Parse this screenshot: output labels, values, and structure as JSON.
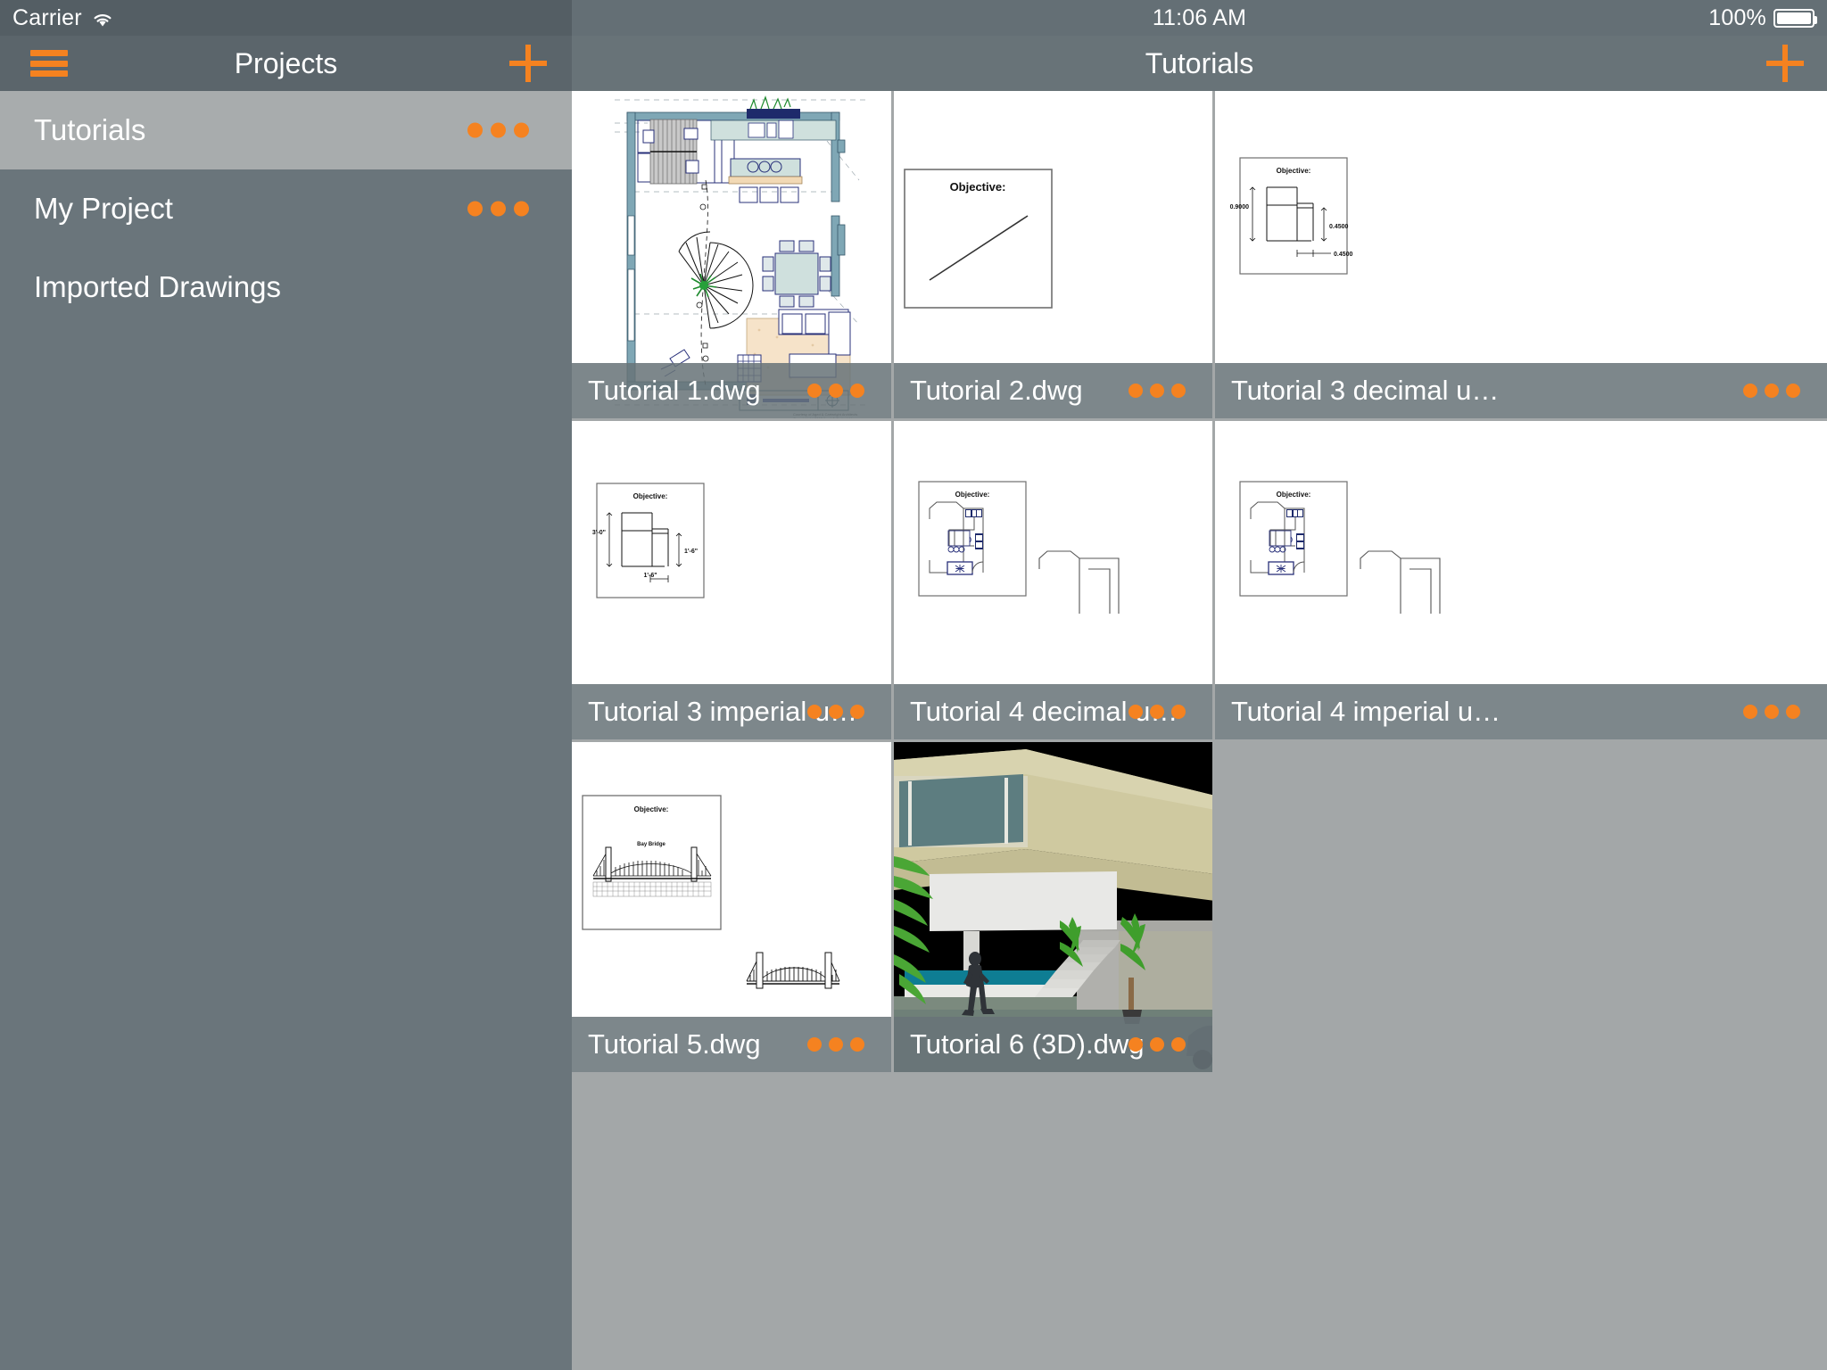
{
  "status_bar": {
    "carrier": "Carrier",
    "wifi_icon": "wifi-icon",
    "time": "11:06 AM",
    "battery_percent": "100%",
    "battery_icon": "battery-full-icon"
  },
  "sidebar": {
    "nav": {
      "title": "Projects",
      "menu_icon": "hamburger-icon",
      "add_icon": "plus-icon"
    },
    "items": [
      {
        "label": "Tutorials",
        "selected": true,
        "has_more": true,
        "more_icon": "more-dots-icon"
      },
      {
        "label": "My Project",
        "selected": false,
        "has_more": true,
        "more_icon": "more-dots-icon"
      },
      {
        "label": "Imported Drawings",
        "selected": false,
        "has_more": false,
        "more_icon": ""
      }
    ]
  },
  "content": {
    "nav": {
      "title": "Tutorials",
      "add_icon": "plus-icon"
    },
    "tiles": [
      {
        "label": "Tutorial 1.dwg",
        "thumb": "floorplan",
        "more_icon": "more-dots-icon"
      },
      {
        "label": "Tutorial 2.dwg",
        "thumb": "objective-line",
        "more_icon": "more-dots-icon"
      },
      {
        "label": "Tutorial 3 decimal u…",
        "thumb": "objective-decimal",
        "more_icon": "more-dots-icon"
      },
      {
        "label": "Tutorial 3 imperial u…",
        "thumb": "objective-imperial",
        "more_icon": "more-dots-icon"
      },
      {
        "label": "Tutorial 4 decimal u…",
        "thumb": "objective-kitchen",
        "more_icon": "more-dots-icon"
      },
      {
        "label": "Tutorial 4 imperial u…",
        "thumb": "objective-kitchen",
        "more_icon": "more-dots-icon"
      },
      {
        "label": "Tutorial 5.dwg",
        "thumb": "objective-bridge",
        "more_icon": "more-dots-icon"
      },
      {
        "label": "Tutorial 6 (3D).dwg",
        "thumb": "render-3d",
        "more_icon": "more-dots-icon"
      }
    ],
    "thumbnail_text": {
      "objective_caption": "Objective:",
      "decimal_dims": [
        "0.9000",
        "0.4500",
        "0.4500"
      ],
      "imperial_dims": [
        "3'-0\"",
        "1'-6\"",
        "1'-6\""
      ],
      "bridge_title": "Bay Bridge",
      "floorplan_credit": "Courtesy of Aged & Cartwright Architects\nCopyright (c) 2013 Aged & Cartwright"
    }
  },
  "colors": {
    "accent": "#f58220",
    "status_left_bg": "#545e64",
    "status_right_bg": "#646f75",
    "nav_left_bg": "#5b656b",
    "nav_right_bg": "#687378",
    "sidebar_bg": "#6a757b",
    "sidebar_selected_bg": "#a8acad",
    "grid_bg": "#a3a7a8",
    "text": "#ffffff"
  }
}
